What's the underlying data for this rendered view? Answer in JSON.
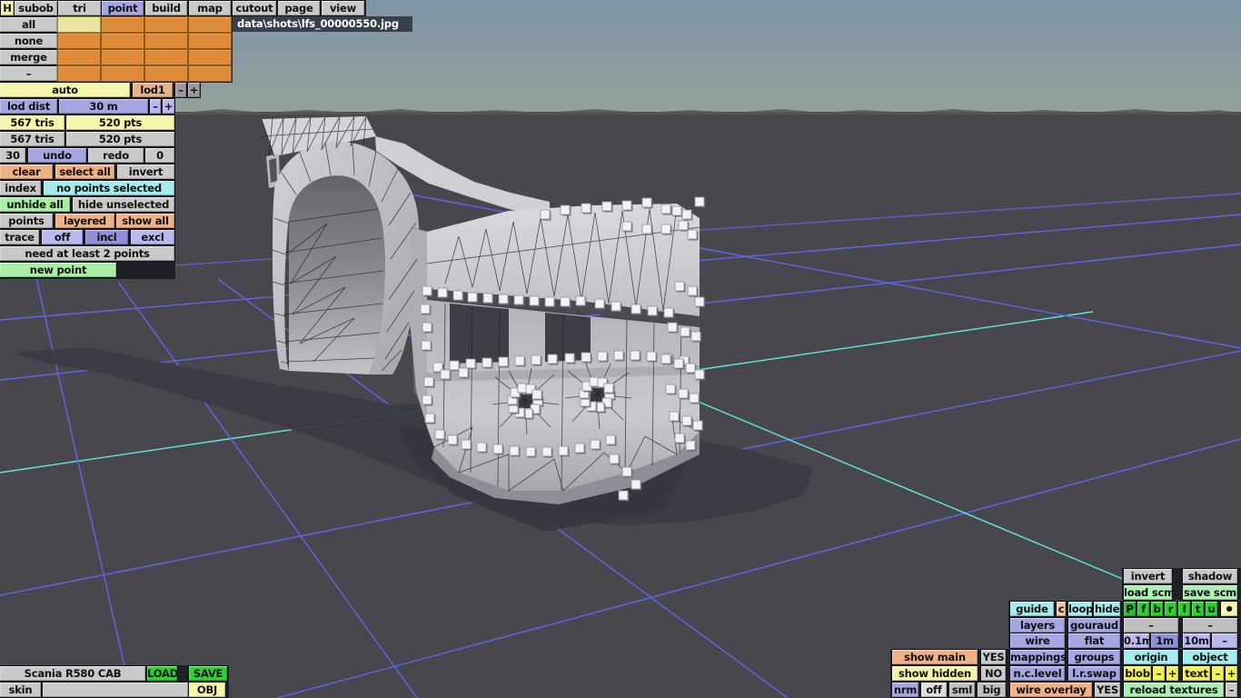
{
  "window": {
    "title": "data\\shots\\lfs_00000550.jpg"
  },
  "menu": {
    "tabs": [
      "H",
      "subob",
      "tri",
      "point",
      "build",
      "map",
      "cutout",
      "page",
      "view"
    ],
    "active_tab": "point"
  },
  "subgrid": {
    "row_labels": [
      "all",
      "none",
      "merge",
      "–"
    ]
  },
  "lod": {
    "auto": "auto",
    "level": "lod1",
    "minus": "–",
    "plus": "+",
    "dist_label": "lod dist",
    "dist_value": "30 m"
  },
  "stats": {
    "tris_selected": "567 tris",
    "pts_selected": "520 pts",
    "tris_total": "567 tris",
    "pts_total": "520 pts",
    "undo_count": "30",
    "undo": "undo",
    "redo": "redo",
    "redo_count": "0"
  },
  "select": {
    "clear": "clear",
    "select_all": "select all",
    "invert": "invert",
    "index": "index",
    "status": "no points selected",
    "unhide_all": "unhide all",
    "hide_unselected": "hide unselected",
    "points": "points",
    "layered": "layered",
    "show_all": "show all",
    "trace": "trace",
    "off": "off",
    "incl": "incl",
    "excl": "excl",
    "hint": "need at least 2 points",
    "new_point": "new point"
  },
  "object": {
    "name": "Scania R580 CAB",
    "load": "LOAD",
    "save": "SAVE",
    "skin": "skin",
    "skin_value": "",
    "obj": "OBJ"
  },
  "rp": {
    "invert": "invert",
    "shadow": "shadow",
    "load_scm": "load scm",
    "save_scm": "save scm",
    "guide": "guide",
    "c": "c",
    "loop": "loop",
    "hide": "hide",
    "views": [
      "P",
      "f",
      "b",
      "r",
      "l",
      "t",
      "u",
      "●"
    ],
    "layers": "layers",
    "gouraud": "gouraud",
    "dash_a": "–",
    "dash_b": "–",
    "wire": "wire",
    "flat": "flat",
    "g01": "0.1m",
    "g1": "1m",
    "g10": "10m",
    "g_dash": "–",
    "show_main": "show main",
    "show_main_val": "YES",
    "mappings": "mappings",
    "groups": "groups",
    "origin": "origin",
    "object": "object",
    "show_hidden": "show hidden",
    "show_hidden_val": "NO",
    "nc_level": "n.c.level",
    "lr_swap": "l.r.swap",
    "blob": "blob",
    "blob_minus": "–",
    "blob_plus": "+",
    "text": "text",
    "text_minus": "–",
    "text_plus": "+",
    "nrm": "nrm",
    "off": "off",
    "sml": "sml",
    "big": "big",
    "wire_overlay": "wire overlay",
    "wire_overlay_val": "YES",
    "reload": "reload textures",
    "reload_dash": "–"
  },
  "viewport": {
    "colors": {
      "sky_top": "#7e95a8",
      "sky_horizon": "#93a09a",
      "ground": "#47474d",
      "grid_blue": "#6066e8",
      "grid_cyan": "#5fe8dc",
      "shadow": "#3b3b43",
      "model": "#c9c9ce",
      "wireframe": "#1e1e22",
      "handle": "#f2f2f4"
    }
  }
}
